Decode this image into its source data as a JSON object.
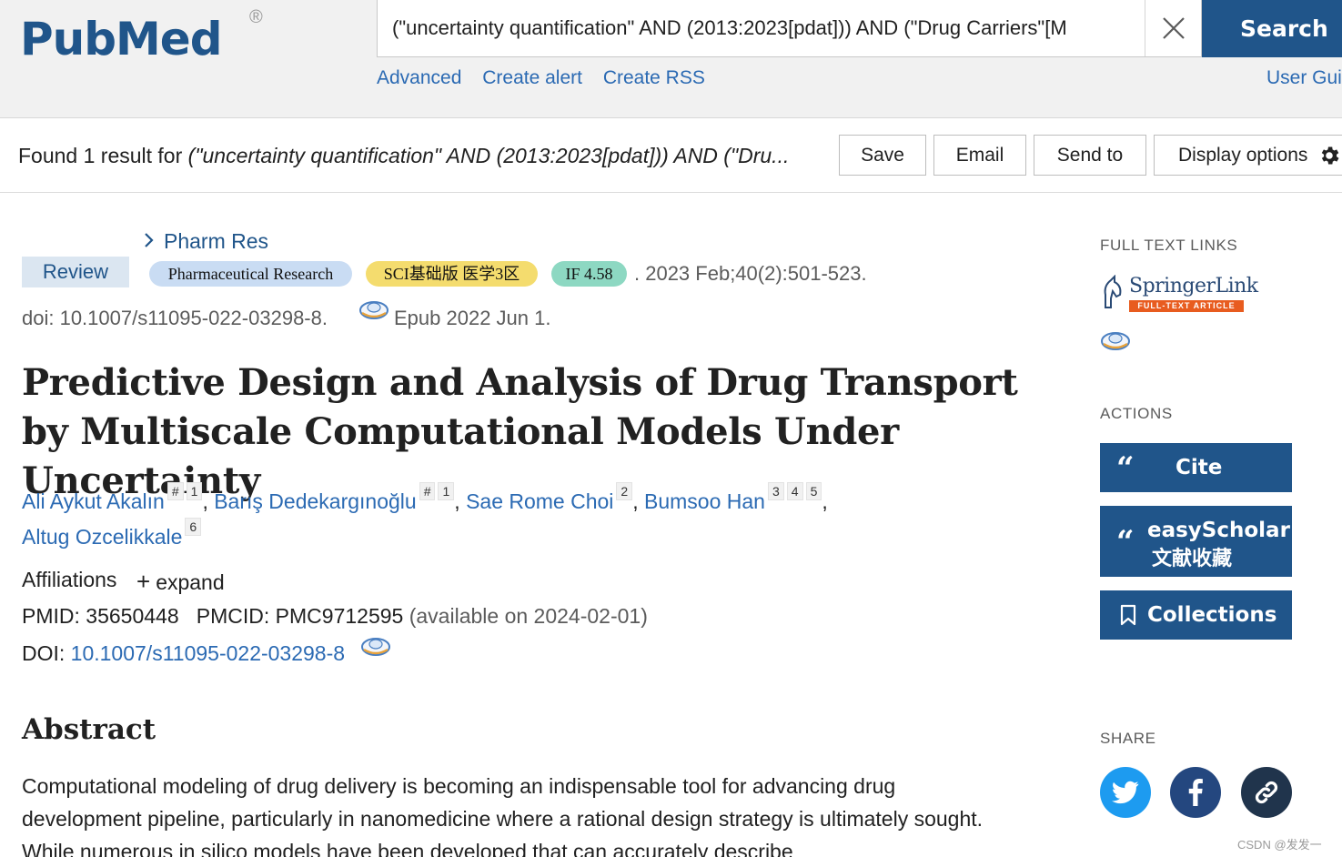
{
  "header": {
    "logo": "PubMed",
    "logo_reg": "®",
    "search_query": "(\"uncertainty quantification\" AND (2013:2023[pdat])) AND (\"Drug Carriers\"[M",
    "search_button": "Search",
    "links": [
      "Advanced",
      "Create alert",
      "Create RSS"
    ],
    "user_guide": "User Guic"
  },
  "results": {
    "found_prefix": "Found 1 result for ",
    "found_query": "(\"uncertainty quantification\" AND (2013:2023[pdat])) AND (\"Dru...",
    "buttons": {
      "save": "Save",
      "email": "Email",
      "send_to": "Send to",
      "display_options": "Display options"
    }
  },
  "article": {
    "journal_link": "Pharm Res",
    "type_badge": "Review",
    "tags": {
      "journal": "Pharmaceutical Research",
      "sci": "SCI基础版 医学3区",
      "impact": "IF 4.58"
    },
    "citation": ". 2023 Feb;40(2):501-523.",
    "doi_text": "doi: 10.1007/s11095-022-03298-8.",
    "epub": "Epub 2022 Jun 1.",
    "title": "Predictive Design and Analysis of Drug Transport by Multiscale Computational Models Under Uncertainty",
    "authors": [
      {
        "name": "Ali Aykut Akalın",
        "marks": [
          "#",
          "1"
        ]
      },
      {
        "name": "Barış Dedekargınoğlu",
        "marks": [
          "#",
          "1"
        ]
      },
      {
        "name": "Sae Rome Choi",
        "marks": [
          "2"
        ]
      },
      {
        "name": "Bumsoo Han",
        "marks": [
          "3",
          "4",
          "5"
        ]
      },
      {
        "name": "Altug Ozcelikkale",
        "marks": [
          "6"
        ]
      }
    ],
    "affiliations_label": "Affiliations",
    "expand_label": "expand",
    "pmid": "PMID: 35650448",
    "pmcid": "PMCID: PMC9712595",
    "pmc_available": "(available on 2024-02-01)",
    "doi_label": "DOI: ",
    "doi_link": "10.1007/s11095-022-03298-8",
    "abstract_heading": "Abstract",
    "abstract_text": "Computational modeling of drug delivery is becoming an indispensable tool for advancing drug development pipeline, particularly in nanomedicine where a rational design strategy is ultimately sought. While numerous in silico models have been developed that can accurately describe"
  },
  "sidebar": {
    "full_text_heading": "FULL TEXT LINKS",
    "springer_name": "SpringerLink",
    "springer_sub": "FULL-TEXT ARTICLE",
    "actions_heading": "ACTIONS",
    "cite": "Cite",
    "easyscholar_line1": "easyScholar",
    "easyscholar_line2": "文献收藏",
    "collections": "Collections",
    "share_heading": "SHARE"
  },
  "watermark": "CSDN @发发一",
  "colors": {
    "brand": "#20558a",
    "link": "#2b6ab3",
    "twitter": "#1d9bf0",
    "facebook": "#24477f"
  }
}
